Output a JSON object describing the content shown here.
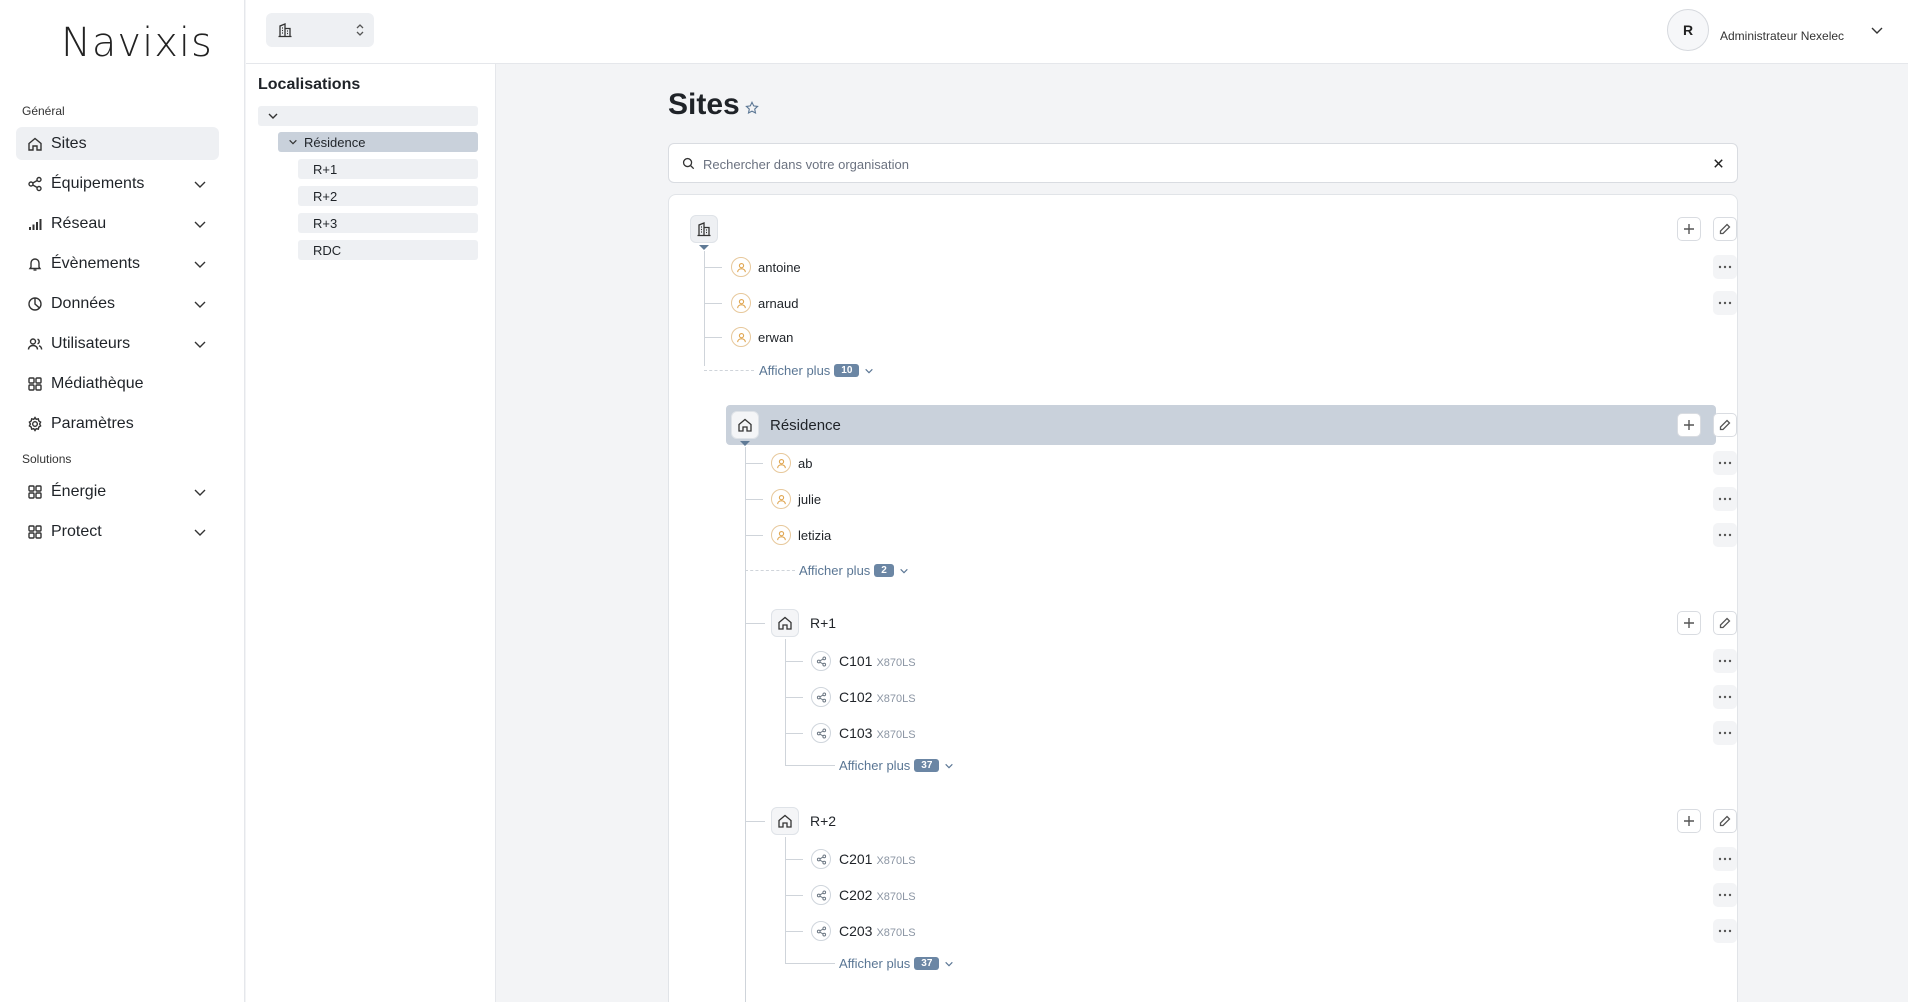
{
  "logo": "Navixis",
  "nav": {
    "section_general": "Général",
    "section_solutions": "Solutions",
    "items": [
      {
        "label": "Sites",
        "icon": "home-icon"
      },
      {
        "label": "Équipements",
        "icon": "share-icon"
      },
      {
        "label": "Réseau",
        "icon": "signal-icon"
      },
      {
        "label": "Évènements",
        "icon": "bell-icon"
      },
      {
        "label": "Données",
        "icon": "pie-chart-icon"
      },
      {
        "label": "Utilisateurs",
        "icon": "users-icon"
      },
      {
        "label": "Médiathèque",
        "icon": "grid-icon"
      },
      {
        "label": "Paramètres",
        "icon": "gear-icon"
      }
    ],
    "solutions": [
      {
        "label": "Énergie",
        "icon": "grid-icon"
      },
      {
        "label": "Protect",
        "icon": "grid-icon"
      }
    ]
  },
  "topbar": {
    "user_initial": "R",
    "user_name": "Administrateur Nexelec"
  },
  "localisations": {
    "title": "Localisations",
    "items": [
      "Résidence",
      "R+1",
      "R+2",
      "R+3",
      "RDC"
    ]
  },
  "main": {
    "title": "Sites",
    "search_placeholder": "Rechercher dans votre organisation"
  },
  "tree": {
    "root_users": [
      "antoine",
      "arnaud",
      "erwan"
    ],
    "root_more": {
      "label": "Afficher plus",
      "count": "10"
    },
    "residence": {
      "label": "Résidence",
      "users": [
        "ab",
        "julie",
        "letizia"
      ],
      "more": {
        "label": "Afficher plus",
        "count": "2"
      }
    },
    "r1": {
      "label": "R+1",
      "equipments": [
        {
          "name": "C101",
          "model": "X870LS"
        },
        {
          "name": "C102",
          "model": "X870LS"
        },
        {
          "name": "C103",
          "model": "X870LS"
        }
      ],
      "more": {
        "label": "Afficher plus",
        "count": "37"
      }
    },
    "r2": {
      "label": "R+2",
      "equipments": [
        {
          "name": "C201",
          "model": "X870LS"
        },
        {
          "name": "C202",
          "model": "X870LS"
        },
        {
          "name": "C203",
          "model": "X870LS"
        }
      ],
      "more": {
        "label": "Afficher plus",
        "count": "37"
      }
    }
  },
  "colors": {
    "accent": "#5a7694",
    "badge": "#6b86a4",
    "selected_band": "#c9d1db",
    "person_ring": "#e7c89b"
  }
}
